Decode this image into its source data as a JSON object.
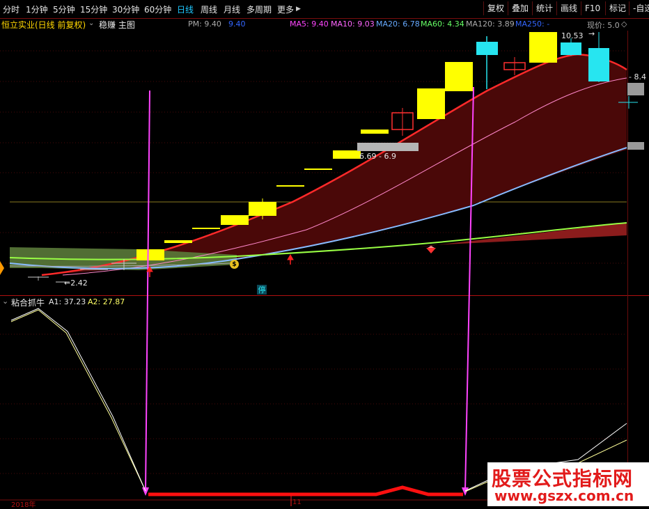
{
  "toolbar": {
    "periods": [
      "分时",
      "1分钟",
      "5分钟",
      "15分钟",
      "30分钟",
      "60分钟",
      "日线",
      "周线",
      "月线",
      "多周期",
      "更多"
    ],
    "active_period": "日线",
    "more_arrow": "▶",
    "buttons": [
      "复权",
      "叠加",
      "统计",
      "画线",
      "F10",
      "标记",
      "-自选"
    ]
  },
  "header": {
    "stock_name": "恒立实业(日线 前复权)",
    "mode_label": "稳赚 主图",
    "pm_label": "PM: 9.40",
    "pm_value": "9.40",
    "ma5": "MA5: 9.40",
    "ma10": "MA10: 9.03",
    "ma20": "MA20: 6.78",
    "ma60": "MA60: 4.34",
    "ma120": "MA120: 3.89",
    "ma250": "MA250: -",
    "current_price": "现价: 5.0"
  },
  "price_labels": {
    "high": "10.53",
    "low": "2.42",
    "right_level": "8.4",
    "range": "6.69 - 6.9"
  },
  "markers": {
    "limit_up": "停",
    "coin": "$"
  },
  "indicator": {
    "name": "粘合抓牛",
    "a1": "A1: 37.23",
    "a2": "A2: 27.87"
  },
  "axis": {
    "year": "2018年",
    "month": "11"
  },
  "watermark": {
    "cn": "股票公式指标网",
    "url": "www.gszx.com.cn"
  },
  "colors": {
    "bg": "#000000",
    "up_candle": "#ffff00",
    "down_candle": "#ff3030",
    "cyan_candle": "#27e5f0",
    "ma5": "#ff44ff",
    "ma10": "#ff66ff",
    "ma20": "#66aaff",
    "ma60": "#66ff66",
    "ma120": "#aaaaaa",
    "ma250": "#3366ff",
    "active_tab": "#1ec8ff",
    "stock_name": "#ffd700",
    "arrow_magenta": "#ff44ff"
  }
}
